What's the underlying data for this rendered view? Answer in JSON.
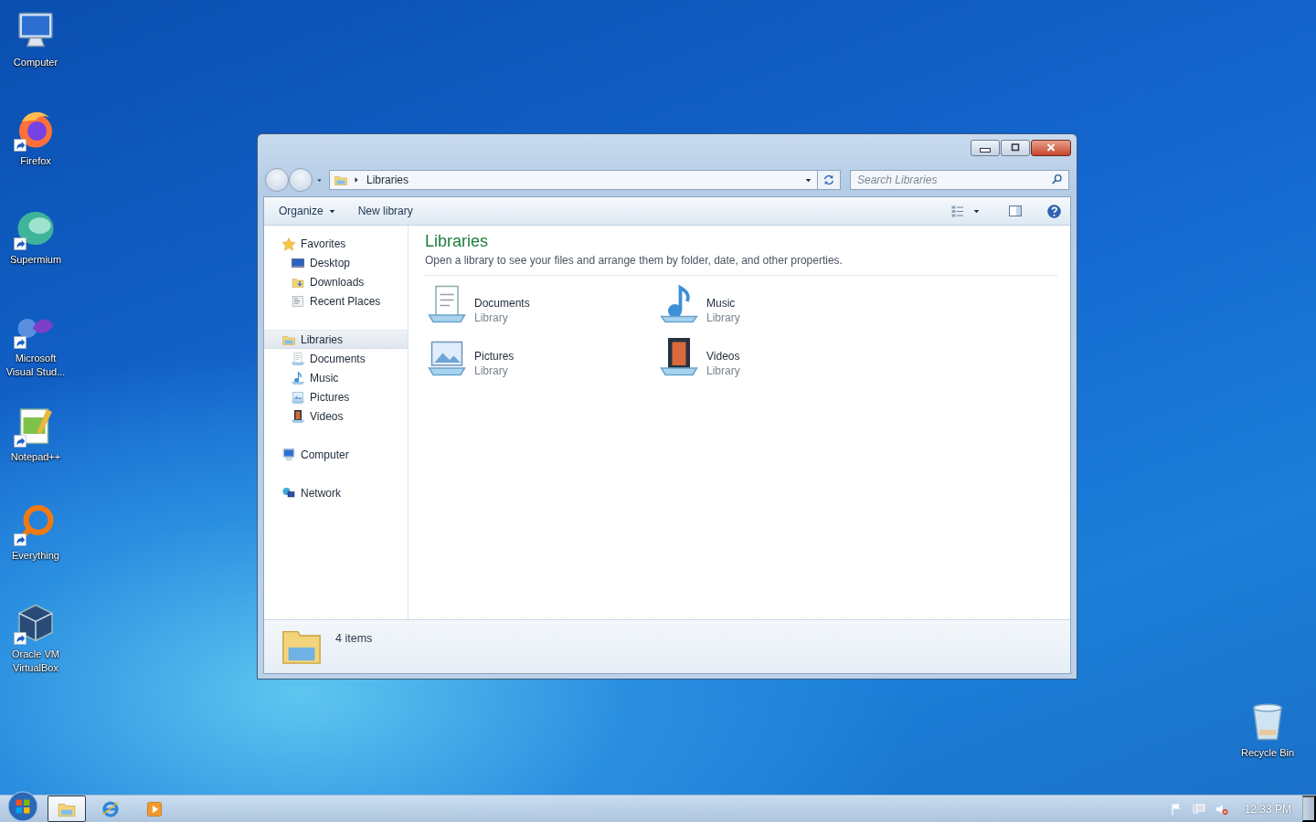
{
  "desktop_icons": [
    {
      "label": "Computer",
      "kind": "computer",
      "shortcut": false
    },
    {
      "label": "Firefox",
      "kind": "firefox",
      "shortcut": true
    },
    {
      "label": "Supermium",
      "kind": "supermium",
      "shortcut": true
    },
    {
      "label": "Microsoft Visual Stud...",
      "kind": "vs",
      "shortcut": true
    },
    {
      "label": "Notepad++",
      "kind": "notepad",
      "shortcut": true
    },
    {
      "label": "Everything",
      "kind": "everything",
      "shortcut": true
    },
    {
      "label": "Oracle VM VirtualBox",
      "kind": "vbox",
      "shortcut": true
    }
  ],
  "recycle_bin": {
    "label": "Recycle Bin"
  },
  "window": {
    "address": {
      "segments": [
        "Libraries"
      ]
    },
    "search": {
      "placeholder": "Search Libraries"
    },
    "toolbar": [
      {
        "label": "Organize",
        "dropdown": true
      },
      {
        "label": "New library",
        "dropdown": false
      }
    ],
    "nav": [
      {
        "label": "Favorites",
        "kind": "star",
        "selected": false,
        "children": [
          {
            "label": "Desktop",
            "kind": "desktop",
            "selected": false
          },
          {
            "label": "Downloads",
            "kind": "downloads",
            "selected": false
          },
          {
            "label": "Recent Places",
            "kind": "recent",
            "selected": false
          }
        ]
      },
      {
        "label": "Libraries",
        "kind": "library",
        "selected": true,
        "children": [
          {
            "label": "Documents",
            "kind": "documents",
            "selected": false
          },
          {
            "label": "Music",
            "kind": "music",
            "selected": false
          },
          {
            "label": "Pictures",
            "kind": "pictures",
            "selected": false
          },
          {
            "label": "Videos",
            "kind": "videos",
            "selected": false
          }
        ]
      },
      {
        "label": "Computer",
        "kind": "computer",
        "selected": false
      },
      {
        "label": "Network",
        "kind": "network",
        "selected": false
      }
    ],
    "content": {
      "title": "Libraries",
      "description": "Open a library to see your files and arrange them by folder, date, and other properties.",
      "items": [
        {
          "name": "Documents",
          "type": "Library",
          "kind": "documents"
        },
        {
          "name": "Music",
          "type": "Library",
          "kind": "music"
        },
        {
          "name": "Pictures",
          "type": "Library",
          "kind": "pictures"
        },
        {
          "name": "Videos",
          "type": "Library",
          "kind": "videos"
        }
      ]
    },
    "status": {
      "count": "4 items"
    }
  },
  "taskbar": {
    "items": [
      {
        "kind": "explorer",
        "selected": true
      },
      {
        "kind": "ie",
        "selected": false
      },
      {
        "kind": "media",
        "selected": false
      }
    ],
    "clock": "12:33 PM"
  }
}
